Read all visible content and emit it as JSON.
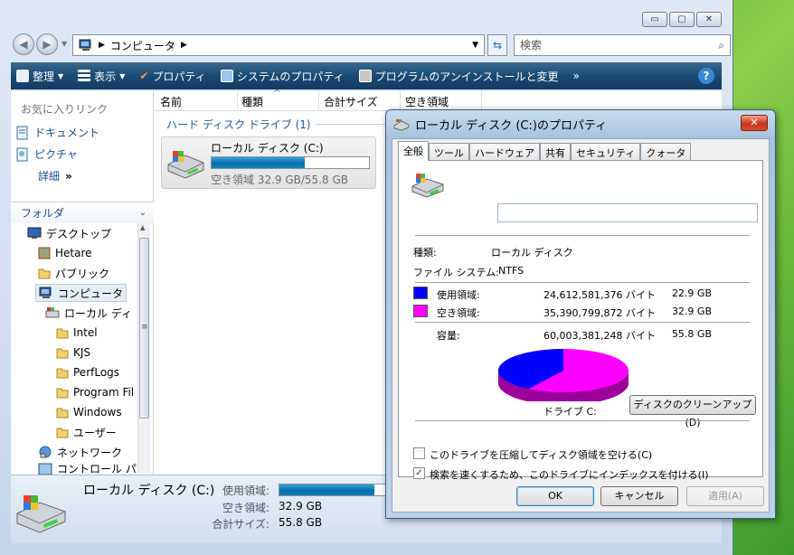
{
  "explorer": {
    "caption_buttons": {
      "minimize": "▭",
      "maximize": "▢",
      "close": "✕"
    },
    "address": {
      "path": "コンピュータ"
    },
    "search": {
      "placeholder": "検索"
    },
    "toolbar": {
      "organize": "整理",
      "view": "表示",
      "properties": "プロパティ",
      "system_properties": "システムのプロパティ",
      "uninstall": "プログラムのアンインストールと変更",
      "more": "»"
    },
    "favorites": {
      "title": "お気に入りリンク",
      "items": [
        "ドキュメント",
        "ピクチャ"
      ],
      "more": "詳細"
    },
    "folders": {
      "header": "フォルダ",
      "items": [
        "デスクトップ",
        "Hetare",
        "パブリック",
        "コンピュータ",
        "ローカル ディ",
        "Intel",
        "KJS",
        "PerfLogs",
        "Program Fil",
        "Windows",
        "ユーザー",
        "ネットワーク",
        "コントロール パ"
      ]
    },
    "columns": [
      "名前",
      "種類",
      "合計サイズ",
      "空き領域"
    ],
    "group_title": "ハード ディスク ドライブ (1)",
    "drive": {
      "name": "ローカル ディスク (C:)",
      "free_text": "空き領域 32.9 GB/55.8 GB",
      "used_fraction": 0.59
    },
    "details": {
      "name": "ローカル ディスク (C:)",
      "used_label": "使用領域:",
      "free_label": "空き領域:",
      "free_value": "32.9 GB",
      "total_label": "合計サイズ:",
      "total_value": "55.8 GB"
    }
  },
  "dialog": {
    "title": "ローカル ディスク (C:)のプロパティ",
    "tabs": [
      "全般",
      "ツール",
      "ハードウェア",
      "共有",
      "セキュリティ",
      "クォータ"
    ],
    "type_label": "種類:",
    "type_value": "ローカル ディスク",
    "fs_label": "ファイル システム:",
    "fs_value": "NTFS",
    "used": {
      "label": "使用領域:",
      "bytes": "24,612,581,376 バイト",
      "size": "22.9 GB",
      "color": "#0000ff"
    },
    "free": {
      "label": "空き領域:",
      "bytes": "35,390,799,872 バイト",
      "size": "32.9 GB",
      "color": "#ff00ff"
    },
    "capacity": {
      "label": "容量:",
      "bytes": "60,003,381,248 バイト",
      "size": "55.8 GB"
    },
    "drive_label": "ドライブ C:",
    "cleanup_button": "ディスクのクリーンアップ(D)",
    "compress": {
      "label": "このドライブを圧縮してディスク領域を空ける(C)",
      "checked": false
    },
    "index": {
      "label": "検索を速くするため、このドライブにインデックスを付ける(I)",
      "checked": true
    },
    "ok": "OK",
    "cancel": "キャンセル",
    "apply": "適用(A)"
  }
}
